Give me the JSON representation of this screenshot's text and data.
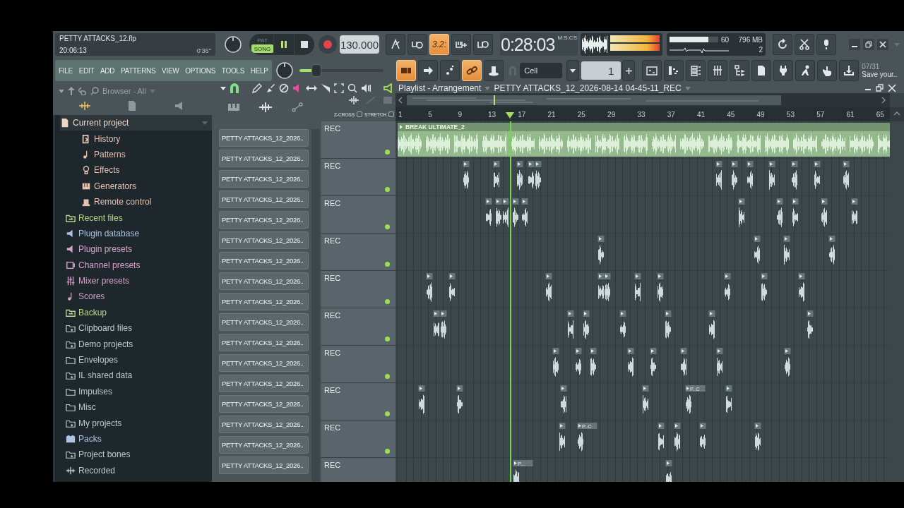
{
  "file": {
    "name": "PETTY ATTACKS_12.flp",
    "clock": "20:06:13",
    "length": "0'36''"
  },
  "transport": {
    "modes": [
      {
        "label": "PAT",
        "selected": false
      },
      {
        "label": "SONG",
        "selected": true
      }
    ],
    "playing": true,
    "tempo": "130.000"
  },
  "record_buttons": [
    {
      "active": false
    },
    {
      "active": false
    },
    {
      "label": "3.2:",
      "active": true
    },
    {
      "active": false
    },
    {
      "active": false
    }
  ],
  "time": {
    "value": "0:28:03",
    "unit": "M:S:CS"
  },
  "cpu": {
    "level": 0.8,
    "voices": "60",
    "memory": "796 MB",
    "polyphony": "2"
  },
  "menu": [
    "FILE",
    "EDIT",
    "ADD",
    "PATTERNS",
    "VIEW",
    "OPTIONS",
    "TOOLS",
    "HELP"
  ],
  "master_pitch": {
    "level": 0.2
  },
  "tool_buttons": [
    {
      "active": true
    },
    {
      "active": false
    },
    {
      "active": false
    },
    {
      "active": true
    },
    {
      "active": false
    }
  ],
  "snap": {
    "value": "Cell"
  },
  "pattern_selector": {
    "value": "1"
  },
  "hint": {
    "date": "07/31",
    "text": "Save your.."
  },
  "browser": {
    "title": "Browser - All",
    "items": [
      {
        "label": "Current project",
        "kind": "project",
        "color": "#ecd8c8",
        "expanded": true,
        "children": [
          {
            "label": "History",
            "kind": "history",
            "color": "#e6c2b4"
          },
          {
            "label": "Patterns",
            "kind": "note",
            "color": "#e6c2b4"
          },
          {
            "label": "Effects",
            "kind": "effect",
            "color": "#e6c2b4"
          },
          {
            "label": "Generators",
            "kind": "piano",
            "color": "#e6c2b4"
          },
          {
            "label": "Remote control",
            "kind": "remote",
            "color": "#e6c2b4"
          }
        ]
      },
      {
        "label": "Recent files",
        "kind": "folder-sync",
        "color": "#b9d88c"
      },
      {
        "label": "Plugin database",
        "kind": "plug",
        "color": "#a9c2e4"
      },
      {
        "label": "Plugin presets",
        "kind": "plug",
        "color": "#d9a2cc"
      },
      {
        "label": "Channel presets",
        "kind": "channel",
        "color": "#d9a2cc"
      },
      {
        "label": "Mixer presets",
        "kind": "mixer",
        "color": "#d9a2cc"
      },
      {
        "label": "Scores",
        "kind": "note",
        "color": "#c9a2c4"
      },
      {
        "label": "Backup",
        "kind": "folder-sync",
        "color": "#b9d88c"
      },
      {
        "label": "Clipboard files",
        "kind": "folder-plus",
        "color": "#bccad2"
      },
      {
        "label": "Demo projects",
        "kind": "folder-plus",
        "color": "#bccad2"
      },
      {
        "label": "Envelopes",
        "kind": "folder",
        "color": "#bccad2"
      },
      {
        "label": "IL shared data",
        "kind": "folder-plus",
        "color": "#bccad2"
      },
      {
        "label": "Impulses",
        "kind": "folder",
        "color": "#bccad2"
      },
      {
        "label": "Misc",
        "kind": "folder",
        "color": "#bccad2"
      },
      {
        "label": "My projects",
        "kind": "folder-plus",
        "color": "#bccad2"
      },
      {
        "label": "Packs",
        "kind": "packs",
        "color": "#b2c4e6"
      },
      {
        "label": "Project bones",
        "kind": "folder-plus",
        "color": "#bccad2"
      },
      {
        "label": "Recorded",
        "kind": "wave",
        "color": "#bccad2"
      }
    ]
  },
  "playlist": {
    "title": "Playlist - Arrangement",
    "arrangement": "PETTY ATTACKS_12_2026-08-14 04-45-11_REC",
    "options": [
      {
        "label": "Z-CROSS",
        "checked": false
      },
      {
        "label": "STRETCH",
        "checked": false
      }
    ],
    "ruler": [
      "1",
      "5",
      "9",
      "13",
      "17",
      "21",
      "25",
      "29",
      "33",
      "37",
      "41",
      "45",
      "49",
      "53",
      "57",
      "61",
      "65"
    ],
    "patterns": [
      "PETTY ATTACKS_12_2026..",
      "PETTY ATTACKS_12_2026..",
      "PETTY ATTACKS_12_2026..",
      "PETTY ATTACKS_12_2026..",
      "PETTY ATTACKS_12_2026..",
      "PETTY ATTACKS_12_2026..",
      "PETTY ATTACKS_12_2026..",
      "PETTY ATTACKS_12_2026..",
      "PETTY ATTACKS_12_2026..",
      "PETTY ATTACKS_12_2026..",
      "PETTY ATTACKS_12_2026..",
      "PETTY ATTACKS_12_2026..",
      "PETTY ATTACKS_12_2026..",
      "PETTY ATTACKS_12_2026..",
      "PETTY ATTACKS_12_2026..",
      "PETTY ATTACKS_12_2026..",
      "PETTY ATTACKS_12_2026.."
    ],
    "tracks": [
      {
        "label": "REC",
        "enabled": true,
        "clip_label": "BREAK ULTIMATE_2"
      },
      {
        "label": "REC",
        "enabled": true
      },
      {
        "label": "REC",
        "enabled": true
      },
      {
        "label": "REC",
        "enabled": true
      },
      {
        "label": "REC",
        "enabled": true
      },
      {
        "label": "REC",
        "enabled": true
      },
      {
        "label": "REC",
        "enabled": true
      },
      {
        "label": "REC",
        "enabled": true,
        "clip_label": "P..C"
      },
      {
        "label": "REC",
        "enabled": true,
        "clip_label": "P..C"
      },
      {
        "label": "REC",
        "clip_label": "P..."
      }
    ]
  }
}
